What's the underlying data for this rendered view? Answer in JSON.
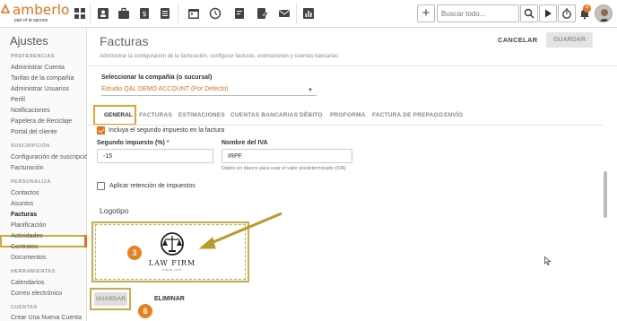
{
  "brand": {
    "name": "amberlo",
    "tagline": "part of ⊛ spcone",
    "accent": "#e8711d"
  },
  "topbar": {
    "icons": [
      "dashboard-icon",
      "contacts-icon",
      "matters-icon",
      "billing-icon",
      "documents-icon",
      "calendar-icon",
      "timer-history-icon",
      "invoices-icon",
      "docs-check-icon",
      "mail-icon",
      "reports-icon"
    ],
    "add_label": "+",
    "search_placeholder": "Buscar todo...",
    "notifications_count": "4"
  },
  "sidebar": {
    "title": "Ajustes",
    "sections": [
      {
        "heading": "PREFERENCIAS",
        "items": [
          "Administrar Cuenta",
          "Tarifas de la compañía",
          "Administrar Usuarios",
          "Perfil",
          "Notificaciones",
          "Papelera de Reciclaje",
          "Portal del cliente"
        ]
      },
      {
        "heading": "SUSCRIPCIÓN",
        "items": [
          "Configuración de suscripción",
          "Facturación"
        ]
      },
      {
        "heading": "PERSONALIZA",
        "items": [
          "Contactos",
          "Asuntos",
          "Facturas",
          "Planificación",
          "Actividades",
          "Contratos",
          "Documentos"
        ]
      },
      {
        "heading": "HERRAMIENTAS",
        "items": [
          "Calendarios",
          "Correo electrónico"
        ]
      },
      {
        "heading": "CUENTAS",
        "items": [
          "Crear Una Nueva Cuenta"
        ]
      }
    ],
    "active_item": "Facturas"
  },
  "header": {
    "title": "Facturas",
    "subtitle": "Administrar la configuración de la facturación, configurar facturas, estimaciones y cuentas bancarias",
    "cancel_label": "CANCELAR",
    "save_label": "GUARDAR"
  },
  "company": {
    "label": "Seleccionar la compañía (o sucursal)",
    "value": "Estudio Q&L DEMO ACCOUNT (Por Defecto)"
  },
  "tabs": [
    "GENERAL",
    "FACTURAS",
    "ESTIMACIONES",
    "CUENTAS BANCARIAS",
    "DÉBITO",
    "PROFORMA",
    "FACTURA DE PREPAGO",
    "ENVÍO"
  ],
  "active_tab": "GENERAL",
  "form": {
    "second_tax_checkbox": "Incluya el segundo impuesto en la factura",
    "second_tax_label": "Segundo impuesto (%)",
    "second_tax_required": "*",
    "second_tax_value": "-15",
    "tax_name_label": "Nombre del IVA",
    "tax_name_value": "IRPF",
    "tax_name_help": "Déjelo en blanco para usar el valor predeterminado (IVA)",
    "withholding_checkbox": "Aplicar retención de impuestos"
  },
  "logo_section": {
    "title": "Logotipo",
    "firm_name": "LAW FIRM",
    "firm_tagline": "SINCE 1975"
  },
  "footer": {
    "save_label": "GUARDAR",
    "delete_label": "ELIMINAR"
  },
  "annotations": {
    "step_logo": "3",
    "step_save": "6",
    "color": "#e8811d",
    "highlight": "#c9ad4a"
  }
}
